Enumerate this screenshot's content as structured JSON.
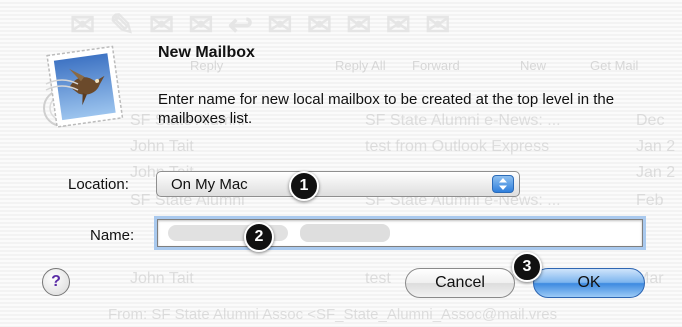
{
  "dialog": {
    "title": "New Mailbox",
    "message": "Enter name for new local mailbox to be created at the top level in the mailboxes list.",
    "location_label": "Location:",
    "location_value": "On My Mac",
    "name_label": "Name:",
    "name_value": "",
    "help_label": "?",
    "cancel_label": "Cancel",
    "ok_label": "OK"
  },
  "annotations": {
    "step1": "1",
    "step2": "2",
    "step3": "3"
  },
  "background": {
    "toolbar_items": [
      "Reply",
      "Reply All",
      "Forward",
      "New",
      "Get Mail"
    ],
    "rows": [
      {
        "from": "SF State Alumni",
        "subject": "SF State Alumni e-News: ...",
        "date": "Dec"
      },
      {
        "from": "John Tait",
        "subject": "test from Outlook Express",
        "date": "Jan 2"
      },
      {
        "from": "John Tait",
        "subject": "...",
        "date": "Jan 2"
      },
      {
        "from": "SF State Alumni",
        "subject": "SF State Alumni e-News: ...",
        "date": "Feb"
      },
      {
        "from": "John Tait",
        "subject": "test",
        "date": "Mar"
      }
    ],
    "footer": "From: SF State Alumni Assoc <SF_State_Alumni_Assoc@mail.vres"
  },
  "colors": {
    "focus_ring": "#a9c9ee",
    "ok_button": "#3d8ae0",
    "help_glyph": "#5b2da6",
    "badge": "#111111"
  },
  "icons": {
    "app": "mail-stamp-eagle-icon",
    "popup": "popup-arrows-icon",
    "help": "help-icon"
  }
}
